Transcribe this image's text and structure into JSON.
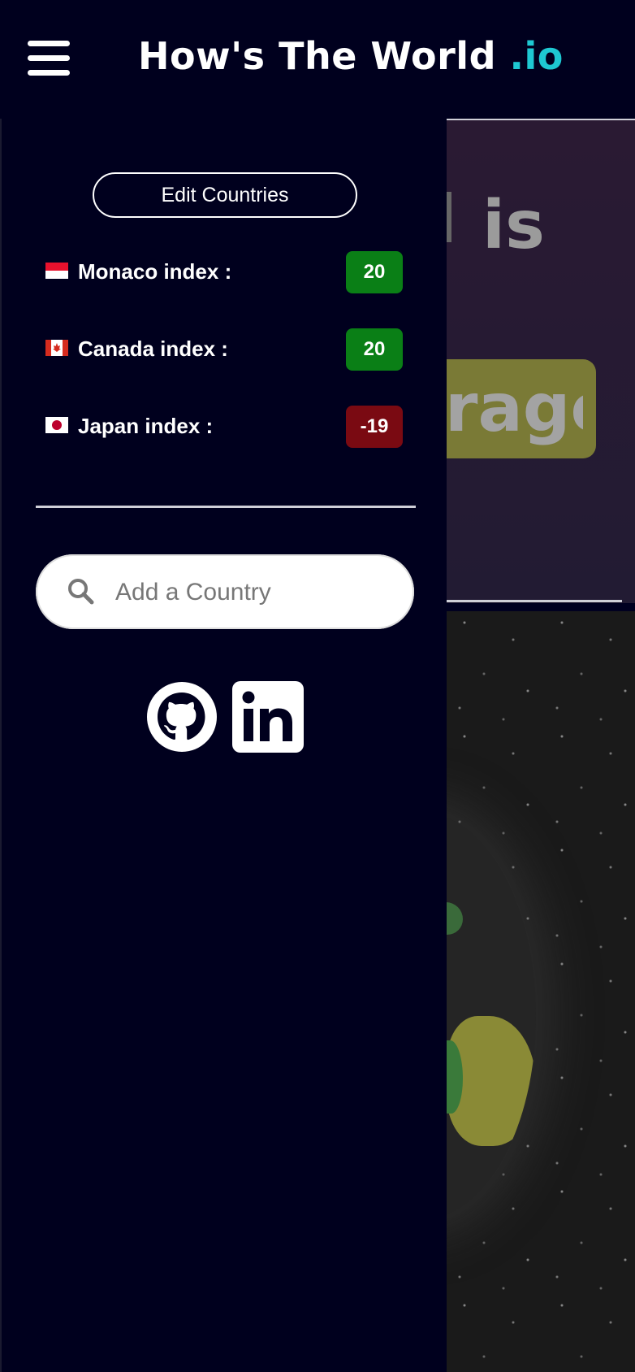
{
  "header": {
    "brand_main": "How's The World",
    "brand_tld": ".io",
    "menu_icon": "hamburger-menu-icon"
  },
  "background": {
    "heading_fragment": "is",
    "badge_fragment": "rage"
  },
  "drawer": {
    "edit_button_label": "Edit Countries",
    "countries": [
      {
        "name_label": "Monaco index :",
        "value": "20",
        "status_color": "#0a7f16",
        "flag": "monaco-flag-icon"
      },
      {
        "name_label": "Canada index :",
        "value": "20",
        "status_color": "#0a7f16",
        "flag": "canada-flag-icon"
      },
      {
        "name_label": "Japan index :",
        "value": "-19",
        "status_color": "#7a0a12",
        "flag": "japan-flag-icon"
      }
    ],
    "search": {
      "placeholder": "Add a Country",
      "icon": "search-icon"
    },
    "social": [
      {
        "name": "github",
        "icon": "github-icon"
      },
      {
        "name": "linkedin",
        "icon": "linkedin-icon"
      }
    ]
  },
  "colors": {
    "background": "#00001e",
    "accent": "#1ec8d2",
    "positive": "#0a7f16",
    "negative": "#7a0a12"
  }
}
